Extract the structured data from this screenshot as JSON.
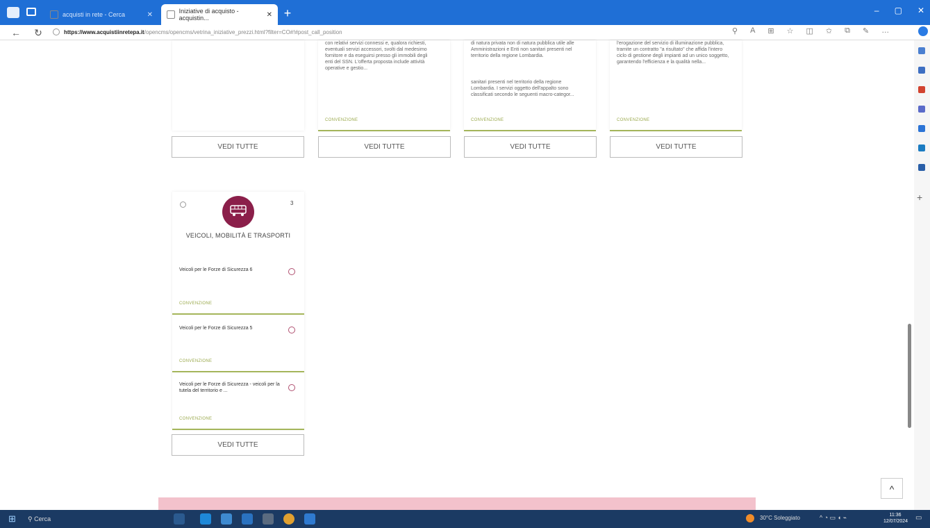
{
  "browser": {
    "tabs": [
      {
        "label": "acquisti in rete - Cerca",
        "active": false
      },
      {
        "label": "Iniziative di acquisto - acquistin...",
        "active": true
      }
    ],
    "url_host": "https://www.acquistiinretepa.it",
    "url_rest": "/opencms/opencms/vetrina_iniziative_prezzi.html?filter=CO#!#post_call_position",
    "new_tab_label": "+",
    "back_label": "←",
    "refresh_label": "↻",
    "win_controls": [
      "–",
      "▢",
      "✕"
    ]
  },
  "cards_top": [
    {
      "text_lines": "con relativi servizi connessi e, qualora richiesti, eventuali servizi accessori, svolti dal medesimo fornitore e da eseguirsi presso gli immobili degli enti del SSN. L'offerta proposta include attività operative e gestio...",
      "link": "CONVENZIONE",
      "button": "VEDI TUTTE"
    },
    {
      "text_lines": "sanitari presenti nel territorio della regione Lombardia. I servizi oggetto dell'appalto sono classificati secondo le seguenti macro-categor...",
      "text_head": "di natura privata non di natura pubblica utile alle Amministrazioni e Enti non sanitari presenti nel territorio della regione Lombardia.",
      "link": "CONVENZIONE",
      "button": "VEDI TUTTE"
    },
    {
      "text_lines": "l'erogazione del servizio di illuminazione pubblica, tramite un contratto \"a risultato\" che affida l'intero ciclo di gestione degli impianti ad un unico soggetto, garantendo l'efficienza e la qualità nella...",
      "link": "CONVENZIONE",
      "button": "VEDI TUTTE"
    }
  ],
  "first_column_button": "VEDI TUTTE",
  "vehicle_card": {
    "count": "3",
    "title": "VEICOLI, MOBILITÀ E TRASPORTI",
    "color": "#8b1f4a",
    "items": [
      {
        "text": "Veicoli per le Forze di Sicurezza 6",
        "link": "CONVENZIONE"
      },
      {
        "text": "Veicoli per le Forze di Sicurezza 5",
        "link": "CONVENZIONE"
      },
      {
        "text": "Veicoli per le Forze di Sicurezza - veicoli per la tutela del territorio e ...",
        "link": "CONVENZIONE"
      }
    ],
    "button": "VEDI TUTTE"
  },
  "back_to_top": "^",
  "taskbar": {
    "search": "Cerca",
    "weather": "30°C Soleggiato",
    "clock_time": "11:36",
    "clock_date": "12/07/2024"
  }
}
